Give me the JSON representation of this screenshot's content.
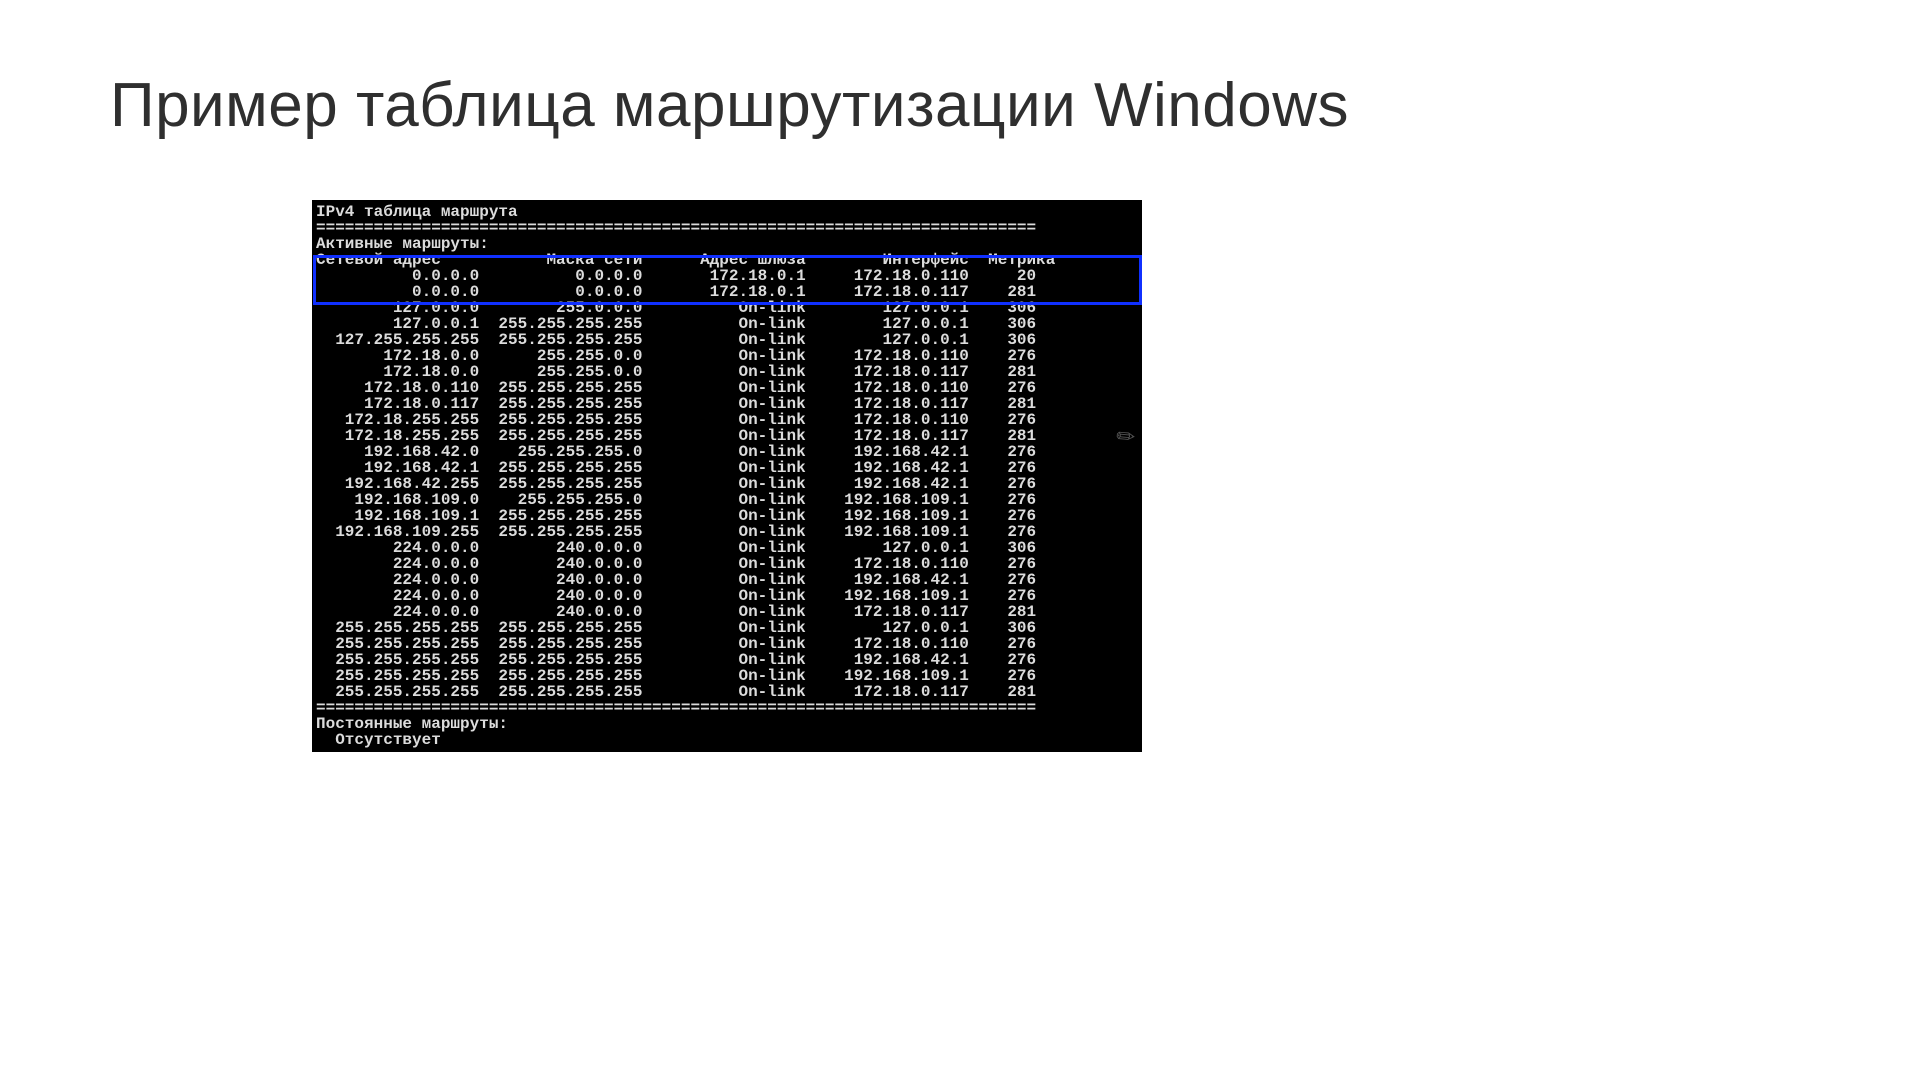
{
  "title": "Пример таблица маршрутизации Windows",
  "terminal": {
    "heading": "IPv4 таблица маршрута",
    "sep": "===========================================================================",
    "active_label": "Активные маршруты:",
    "columns": {
      "net": "Сетевой адрес",
      "mask": "Маска сети",
      "gateway": "Адрес шлюза",
      "iface": "Интерфейс",
      "metric": "Метрика"
    },
    "routes": [
      {
        "net": "0.0.0.0",
        "mask": "0.0.0.0",
        "gw": "172.18.0.1",
        "if": "172.18.0.110",
        "m": "20"
      },
      {
        "net": "0.0.0.0",
        "mask": "0.0.0.0",
        "gw": "172.18.0.1",
        "if": "172.18.0.117",
        "m": "281"
      },
      {
        "net": "127.0.0.0",
        "mask": "255.0.0.0",
        "gw": "On-link",
        "if": "127.0.0.1",
        "m": "306"
      },
      {
        "net": "127.0.0.1",
        "mask": "255.255.255.255",
        "gw": "On-link",
        "if": "127.0.0.1",
        "m": "306"
      },
      {
        "net": "127.255.255.255",
        "mask": "255.255.255.255",
        "gw": "On-link",
        "if": "127.0.0.1",
        "m": "306"
      },
      {
        "net": "172.18.0.0",
        "mask": "255.255.0.0",
        "gw": "On-link",
        "if": "172.18.0.110",
        "m": "276"
      },
      {
        "net": "172.18.0.0",
        "mask": "255.255.0.0",
        "gw": "On-link",
        "if": "172.18.0.117",
        "m": "281"
      },
      {
        "net": "172.18.0.110",
        "mask": "255.255.255.255",
        "gw": "On-link",
        "if": "172.18.0.110",
        "m": "276"
      },
      {
        "net": "172.18.0.117",
        "mask": "255.255.255.255",
        "gw": "On-link",
        "if": "172.18.0.117",
        "m": "281"
      },
      {
        "net": "172.18.255.255",
        "mask": "255.255.255.255",
        "gw": "On-link",
        "if": "172.18.0.110",
        "m": "276"
      },
      {
        "net": "172.18.255.255",
        "mask": "255.255.255.255",
        "gw": "On-link",
        "if": "172.18.0.117",
        "m": "281"
      },
      {
        "net": "192.168.42.0",
        "mask": "255.255.255.0",
        "gw": "On-link",
        "if": "192.168.42.1",
        "m": "276"
      },
      {
        "net": "192.168.42.1",
        "mask": "255.255.255.255",
        "gw": "On-link",
        "if": "192.168.42.1",
        "m": "276"
      },
      {
        "net": "192.168.42.255",
        "mask": "255.255.255.255",
        "gw": "On-link",
        "if": "192.168.42.1",
        "m": "276"
      },
      {
        "net": "192.168.109.0",
        "mask": "255.255.255.0",
        "gw": "On-link",
        "if": "192.168.109.1",
        "m": "276"
      },
      {
        "net": "192.168.109.1",
        "mask": "255.255.255.255",
        "gw": "On-link",
        "if": "192.168.109.1",
        "m": "276"
      },
      {
        "net": "192.168.109.255",
        "mask": "255.255.255.255",
        "gw": "On-link",
        "if": "192.168.109.1",
        "m": "276"
      },
      {
        "net": "224.0.0.0",
        "mask": "240.0.0.0",
        "gw": "On-link",
        "if": "127.0.0.1",
        "m": "306"
      },
      {
        "net": "224.0.0.0",
        "mask": "240.0.0.0",
        "gw": "On-link",
        "if": "172.18.0.110",
        "m": "276"
      },
      {
        "net": "224.0.0.0",
        "mask": "240.0.0.0",
        "gw": "On-link",
        "if": "192.168.42.1",
        "m": "276"
      },
      {
        "net": "224.0.0.0",
        "mask": "240.0.0.0",
        "gw": "On-link",
        "if": "192.168.109.1",
        "m": "276"
      },
      {
        "net": "224.0.0.0",
        "mask": "240.0.0.0",
        "gw": "On-link",
        "if": "172.18.0.117",
        "m": "281"
      },
      {
        "net": "255.255.255.255",
        "mask": "255.255.255.255",
        "gw": "On-link",
        "if": "127.0.0.1",
        "m": "306"
      },
      {
        "net": "255.255.255.255",
        "mask": "255.255.255.255",
        "gw": "On-link",
        "if": "172.18.0.110",
        "m": "276"
      },
      {
        "net": "255.255.255.255",
        "mask": "255.255.255.255",
        "gw": "On-link",
        "if": "192.168.42.1",
        "m": "276"
      },
      {
        "net": "255.255.255.255",
        "mask": "255.255.255.255",
        "gw": "On-link",
        "if": "192.168.109.1",
        "m": "276"
      },
      {
        "net": "255.255.255.255",
        "mask": "255.255.255.255",
        "gw": "On-link",
        "if": "172.18.0.117",
        "m": "281"
      }
    ],
    "persistent_label": "Постоянные маршруты:",
    "persistent_value": "  Отсутствует"
  }
}
